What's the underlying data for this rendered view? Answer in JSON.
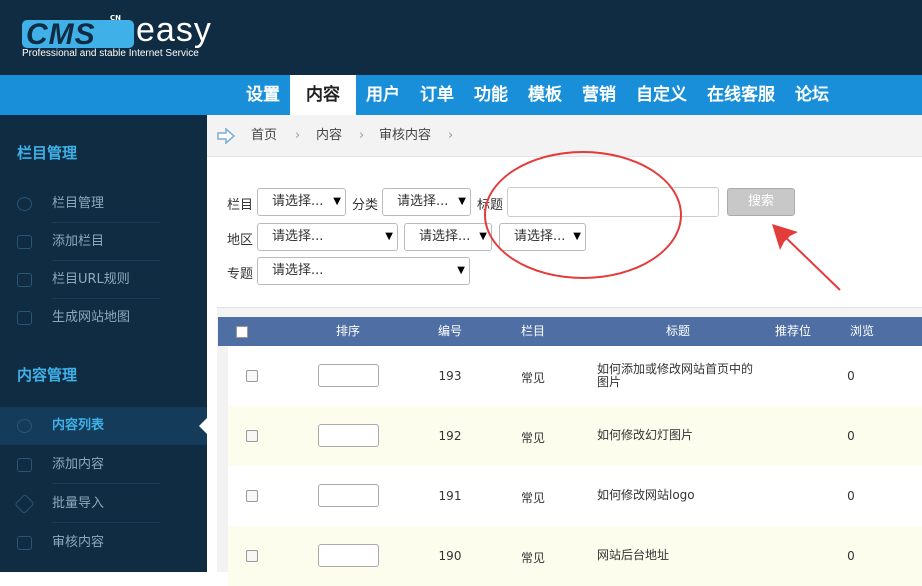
{
  "logo": {
    "cn": "CN",
    "cms": "CMS",
    "easy": "easy",
    "slogan": "Professional and stable Internet Service"
  },
  "nav": {
    "items": [
      "设置",
      "内容",
      "用户",
      "订单",
      "功能",
      "模板",
      "营销",
      "自定义",
      "在线客服",
      "论坛"
    ],
    "active": "内容"
  },
  "sidebar": {
    "section1_title": "栏目管理",
    "section1_items": [
      "栏目管理",
      "添加栏目",
      "栏目URL规则",
      "生成网站地图"
    ],
    "section2_title": "内容管理",
    "section2_items": [
      "内容列表",
      "添加内容",
      "批量导入",
      "审核内容"
    ],
    "active": "内容列表"
  },
  "breadcrumb": [
    "首页",
    "内容",
    "审核内容"
  ],
  "filters": {
    "column_label": "栏目",
    "column_value": "请选择...",
    "category_label": "分类",
    "category_value": "请选择...",
    "title_label": "标题",
    "title_value": "",
    "search_label": "搜索",
    "region_label": "地区",
    "region_value1": "请选择...",
    "region_value2": "请选择...",
    "region_value3": "请选择...",
    "topic_label": "专题",
    "topic_value": "请选择..."
  },
  "table": {
    "headers": {
      "sort": "排序",
      "id": "编号",
      "column": "栏目",
      "title": "标题",
      "recommend": "推荐位",
      "views": "浏览"
    },
    "rows": [
      {
        "id": "193",
        "column": "常见",
        "title": "如何添加或修改网站首页中的图片",
        "views": "0",
        "sort": ""
      },
      {
        "id": "192",
        "column": "常见",
        "title": "如何修改幻灯图片",
        "views": "0",
        "sort": ""
      },
      {
        "id": "191",
        "column": "常见",
        "title": "如何修改网站logo",
        "views": "0",
        "sort": ""
      },
      {
        "id": "190",
        "column": "常见",
        "title": "网站后台地址",
        "views": "0",
        "sort": ""
      }
    ]
  },
  "colors": {
    "header_bg": "#0f2c43",
    "nav_bg": "#1a8fd9",
    "accent": "#3fb0e8",
    "table_head": "#4f6fa4",
    "annotation": "#e43b3b"
  }
}
